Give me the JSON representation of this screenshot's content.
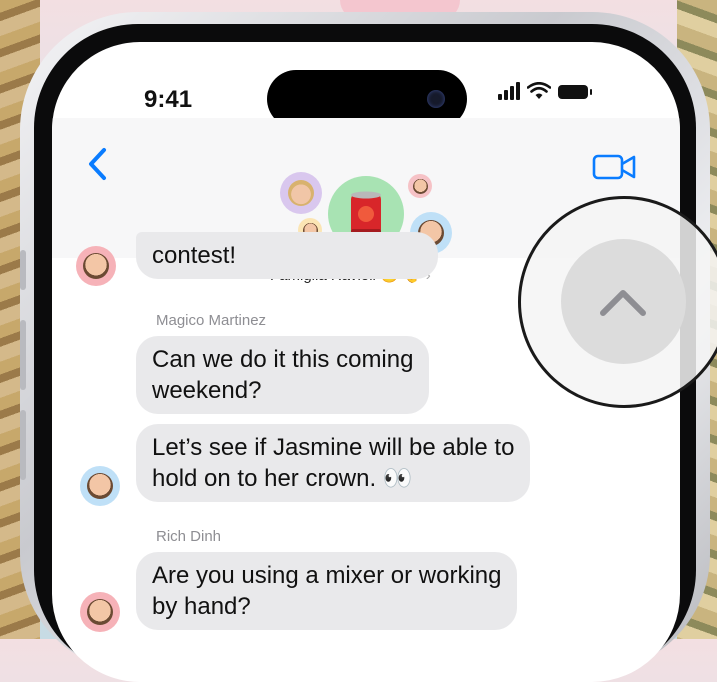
{
  "status_bar": {
    "time": "9:41"
  },
  "header": {
    "group_name": "Famiglia Ravioli",
    "group_emojis": "😶 👌",
    "chevron": "›"
  },
  "messages": [
    {
      "text": "contest!",
      "sender": ""
    },
    {
      "text": "Can we do it this coming weekend?",
      "sender": "Magico Martinez"
    },
    {
      "text": "Let’s see if Jasmine will be able to hold on to her crown. 👀",
      "sender": ""
    },
    {
      "text": "Are you using a mixer or working by hand?",
      "sender": "Rich Dinh"
    }
  ],
  "bubble1_line": "contest!",
  "bubble2_l1": "Can we do it this coming",
  "bubble2_l2": "weekend?",
  "bubble3_l1": "Let’s see if Jasmine will be able to",
  "bubble3_l2": "hold on to her crown. 👀",
  "bubble4_l1": "Are you using a mixer or working",
  "bubble4_l2": "by hand?",
  "senders": {
    "s2": "Magico Martinez",
    "s4": "Rich Dinh"
  },
  "icons": {
    "back": "chevron-left-icon",
    "video": "video-camera-icon",
    "scroll_up": "chevron-up-icon"
  },
  "colors": {
    "accent": "#0a7cff",
    "bubble": "#e9e9eb",
    "sender": "#8e8e93"
  }
}
